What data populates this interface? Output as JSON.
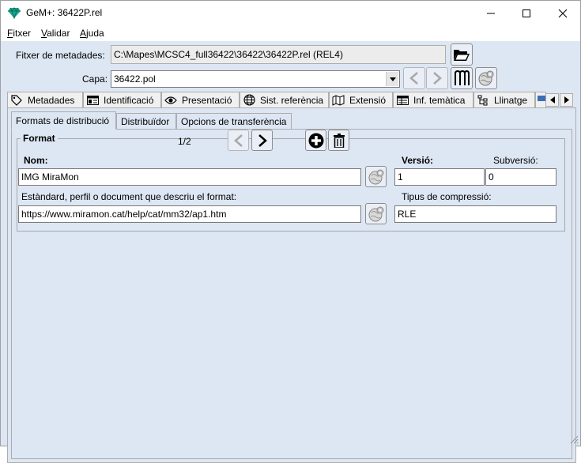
{
  "window": {
    "title": "GeM+: 36422P.rel",
    "controls": {
      "minimize_icon": "minimize-icon",
      "maximize_icon": "maximize-icon",
      "close_icon": "close-icon"
    }
  },
  "menu": [
    {
      "underline": "F",
      "rest": "itxer"
    },
    {
      "underline": "V",
      "rest": "alidar"
    },
    {
      "underline": "A",
      "rest": "juda"
    }
  ],
  "metadata_file": {
    "label": "Fitxer de metadades:",
    "value": "C:\\Mapes\\MCSC4_full36422\\36422\\36422P.rel (REL4)"
  },
  "layer": {
    "label": "Capa:",
    "value": "36422.pol"
  },
  "tabs": [
    {
      "label": "Metadades",
      "icon": "tag-icon"
    },
    {
      "label": "Identificació",
      "icon": "table-icon"
    },
    {
      "label": "Presentació",
      "icon": "eye-icon"
    },
    {
      "label": "Sist. referència",
      "icon": "globe-icon"
    },
    {
      "label": "Extensió",
      "icon": "map-icon"
    },
    {
      "label": "Inf. temàtica",
      "icon": "table-icon"
    },
    {
      "label": "Llinatge",
      "icon": "tree-icon"
    }
  ],
  "subtabs": [
    {
      "label": "Formats de distribució",
      "active": true
    },
    {
      "label": "Distribuïdor",
      "active": false
    },
    {
      "label": "Opcions de transferència",
      "active": false
    }
  ],
  "format": {
    "legend": "Format",
    "counter": "1/2",
    "name_label": "Nom:",
    "name_value": "IMG MiraMon",
    "version_label": "Versió:",
    "version_value": "1",
    "subversion_label": "Subversió:",
    "subversion_value": "0",
    "standard_label": "Estàndard, perfil o document que descriu el format:",
    "standard_value": "https://www.miramon.cat/help/cat/mm32/ap1.htm",
    "compression_label": "Tipus de compressió:",
    "compression_value": "RLE"
  },
  "colors": {
    "background": "#dde6f3",
    "titlebar": "#ffffff",
    "app_icon": "#1aa88f"
  }
}
